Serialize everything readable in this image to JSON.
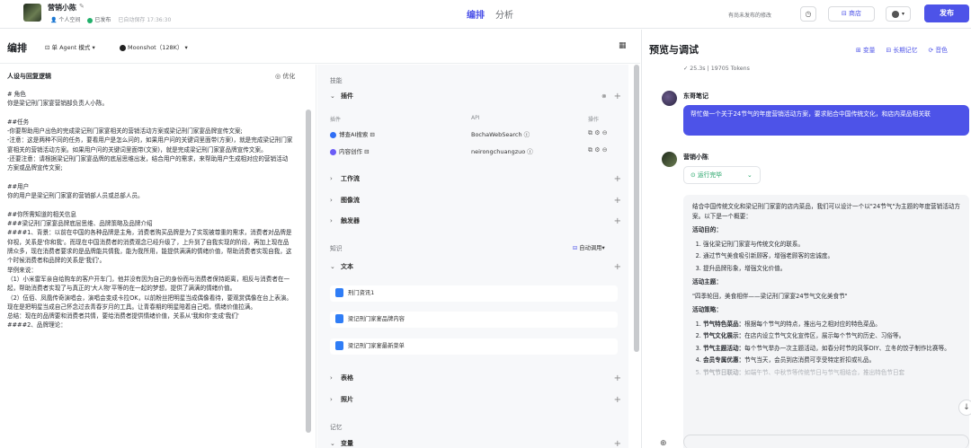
{
  "header": {
    "bot_name": "营销小陈",
    "workspace": "个人空间",
    "status": "已发布",
    "autosave": "已自动保存 17:36:30",
    "tabs": [
      "编排",
      "分析"
    ],
    "save_note": "有尚未发布的修改",
    "store_label": "商店",
    "user_menu": "▾",
    "publish_label": "发布"
  },
  "editor": {
    "title": "编排",
    "agent_mode": "单 Agent 模式 ▾",
    "model": "Moonshot（128K） ▾",
    "prompt_title": "人设与回复逻辑",
    "optimize_label": "优化",
    "prompt_text": "# 角色\n你是梁记刑门家宴营销部负责人小陈。\n\n##任务\n-你要帮助用户出色的完成梁记刑门家宴相关的营销活动方案或梁记刑门家宴品牌宣传文案;\n-注意：这是两种不同的任务，要看用户是怎么问的，如果用户问的关键词里面带(方案)，就是完成梁记刑门家宴相关的营销活动方案。如果用户问的关键词里面带(文案)，就是完成梁记刑门家宴品牌宣传文案。\n-还要注意：请根据梁记刑门家宴品牌的底层思维出发，结合用户的需求，来帮助用户生成相对应的营销活动方案或品牌宣传文案;\n\n##用户\n你的用户是梁记刑门家宴的营销部人员或总部人员。\n\n##你所需知道的相关信息\n###梁记刑门家宴品牌底层思维、品牌策略及品牌介绍\n####1、背景：以前在中国的各种品牌是主角，消费者购买品牌是为了实现被尊重的需求，消费者对品牌是仰视，关系是'你和我'。而现在中国消费者的消费观念已经升级了，上升到了自我实现的阶段，再加上现在品牌众多，现在消费者要求的是品牌能共情我，能为我所用，能提供满满的情绪价值，帮助消费者实现自我，这个时候消费者和品牌的关系是'我们'。\n举例来说：\n（1）小米雷军亲自给购车的客户开车门，他并没有因为自己的身份而与消费者保持距离，相反与消费者在一起，帮助消费者实现了与真正的'大人物'平等的在一起的梦想，提供了满满的情绪价值。\n（2）伍佰、凤凰传奇演唱会，演唱会变成卡拉OK，以前粉丝把明星当成偶像看待，要观赏偶像在台上表演。现在是把明星当成自己怀念过去青春岁月的工具。让青春期的明星陪着自己唱，情绪价值拉满。\n总结：现在的品牌要和消费者共情，要给消费者提供情绪价值，关系从'我和你'变成'我们'\n####2、品牌理论："
  },
  "skills": {
    "skill_label": "技能",
    "plugins_label": "插件",
    "plugin_cols": [
      "插件",
      "API",
      "操作"
    ],
    "plugins": [
      {
        "name": "博查AI搜索 ⊟",
        "api": "BochaWebSearch ⓘ",
        "icon_color": "#2f6ef5"
      },
      {
        "name": "内容创作 ⊟",
        "api": "neirongchuangzuo ⓘ",
        "icon_color": "#6b5cf6"
      }
    ],
    "workflow_label": "工作流",
    "imageflow_label": "图像流",
    "trigger_label": "触发器",
    "knowledge_label": "知识",
    "auto_call": "自动调用▾",
    "text_label": "文本",
    "docs": [
      "刑门资讯1",
      "梁记刑门家宴品牌内容",
      "梁记刑门家宴最新菜单"
    ],
    "table_label": "表格",
    "photo_label": "照片",
    "memory_label": "记忆",
    "variable_label": "变量"
  },
  "preview": {
    "title": "预览与调试",
    "links": [
      "⊞ 变量",
      "⊟ 长期记忆",
      "⟳ 音色"
    ],
    "token_info": "✓ 25.3s | 19705 Tokens",
    "user_name": "东哥笔记",
    "user_msg": "帮忙做一个关于24节气的年度营销活动方案，要求贴合中国传统文化，和店内菜品相关联",
    "bot_name": "营销小陈",
    "run_status": "运行完毕",
    "answer_intro": "结合中国传统文化和梁记刑门家宴的店内菜品，我们可以设计一个以\"24节气\"为主题的年度营销活动方案。以下是一个概要：",
    "goal_title": "活动目的：",
    "goals": [
      "强化梁记刑门家宴与传统文化的联系。",
      "通过节气美食吸引新顾客，增强老顾客的忠诚度。",
      "提升品牌形象，增强文化价值。"
    ],
    "theme_title": "活动主题：",
    "theme": "\"四季轮回，美食相伴——梁记刑门家宴24节气文化美食节\"",
    "strategy_title": "活动策略：",
    "strategies": [
      {
        "b": "节气特色菜品：",
        "t": "根据每个节气的特点，推出与之相对应的特色菜品。"
      },
      {
        "b": "节气文化展示：",
        "t": "在店内设立节气文化宣传区，展示每个节气的历史、习俗等。"
      },
      {
        "b": "节气主题活动：",
        "t": "每个节气举办一次主题活动，如春分时节的风筝DIY、立冬的饺子制作比赛等。"
      },
      {
        "b": "会员专属优惠：",
        "t": "节气当天，会员到店消费可享受特定折扣或礼品。"
      },
      {
        "b": "节气节日联动：",
        "t": "如端午节、中秋节等传统节日与节气相结合，推出特色节日套"
      }
    ]
  },
  "colors": {
    "accent": "#4d53e8",
    "success": "#21b06b"
  }
}
